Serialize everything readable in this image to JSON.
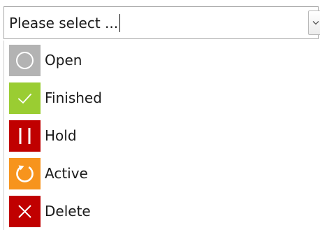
{
  "select": {
    "placeholder": "Please select ..."
  },
  "options": [
    {
      "label": "Open",
      "icon": "circle-icon",
      "color": "#b3b3b3"
    },
    {
      "label": "Finished",
      "icon": "checkmark-icon",
      "color": "#9acd32"
    },
    {
      "label": "Hold",
      "icon": "pause-icon",
      "color": "#c00000"
    },
    {
      "label": "Active",
      "icon": "refresh-icon",
      "color": "#f7941d"
    },
    {
      "label": "Delete",
      "icon": "close-icon",
      "color": "#c00000"
    }
  ]
}
